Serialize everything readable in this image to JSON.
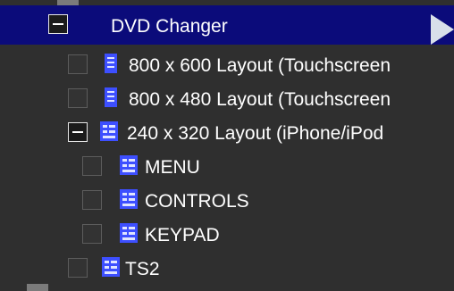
{
  "tree": {
    "selected": {
      "label": "DVD Changer"
    },
    "items": [
      {
        "label": "800 x 600 Layout (Touchscreen",
        "icon": "page-icon"
      },
      {
        "label": "800 x 480 Layout (Touchscreen",
        "icon": "page-icon"
      },
      {
        "label": "240 x 320 Layout (iPhone/iPod",
        "icon": "layout-icon"
      },
      {
        "label": "MENU",
        "icon": "layout-icon"
      },
      {
        "label": "CONTROLS",
        "icon": "layout-icon"
      },
      {
        "label": "KEYPAD",
        "icon": "layout-icon"
      },
      {
        "label": "TS2",
        "icon": "layout-icon"
      }
    ]
  },
  "colors": {
    "background": "#2f2f2f",
    "selection": "#0b0b7a",
    "text": "#ffffff",
    "icon_blue": "#3d4fff"
  }
}
